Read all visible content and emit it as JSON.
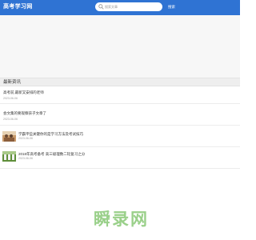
{
  "header": {
    "logo": "高考学习网",
    "search_placeholder": "搜索文章",
    "search_button": "搜索"
  },
  "section": {
    "title": "最新资讯"
  },
  "news": [
    {
      "title": "高考前,最新又安排的老师",
      "date": "2023-06-06"
    },
    {
      "title": "会文集的要观察孩子文章了",
      "date": "2023-06-06"
    },
    {
      "title": "学霸平些关键你的是学习方法及考试技巧",
      "date": "2023-06-06"
    },
    {
      "title": "2018年高考备考 高三级理数二轮复习之分",
      "date": "2023-06-06"
    }
  ],
  "watermark": "瞬录网",
  "colors": {
    "header": "#2f73d3",
    "watermark": "#9ad08a"
  }
}
